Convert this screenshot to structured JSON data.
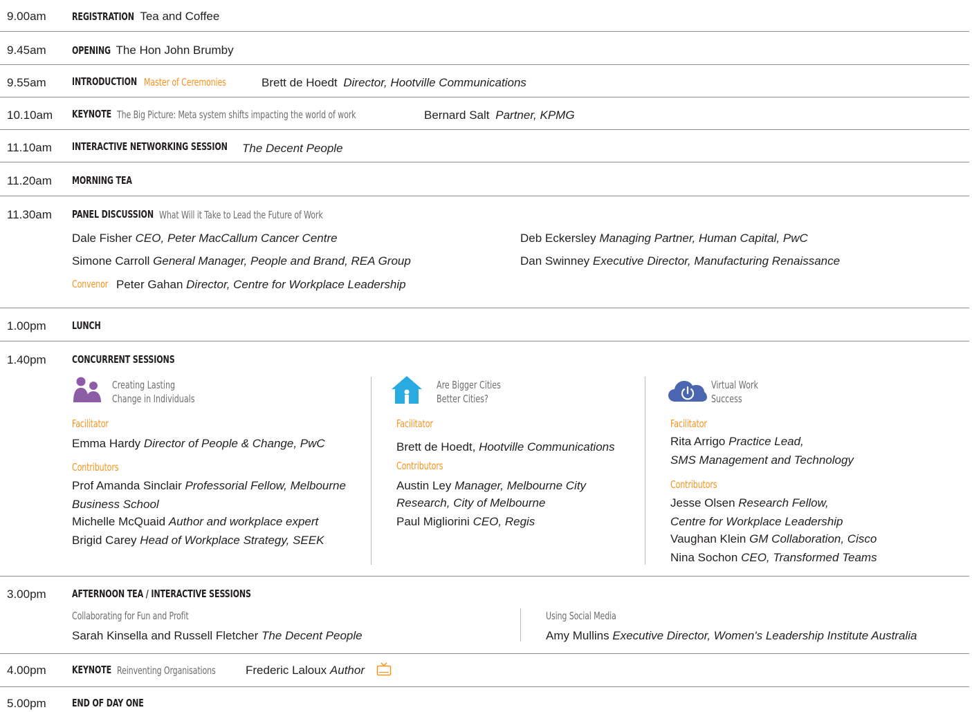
{
  "rows": [
    {
      "time": "9.00am",
      "label": "REGISTRATION",
      "detail": "Tea and Coffee"
    },
    {
      "time": "9.45am",
      "label": "OPENING",
      "detail": "The Hon John Brumby"
    },
    {
      "time": "9.55am",
      "label": "INTRODUCTION",
      "role": "Master of Ceremonies",
      "name": "Brett de Hoedt",
      "title": "Director, Hootville Communications"
    },
    {
      "time": "10.10am",
      "label": "KEYNOTE",
      "topic": "The Big Picture: Meta system shifts impacting the world of work",
      "name": "Bernard Salt",
      "title": "Partner, KPMG"
    },
    {
      "time": "11.10am",
      "label": "INTERACTIVE NETWORKING SESSION",
      "title": "The Decent People"
    },
    {
      "time": "11.20am",
      "label": "MORNING TEA"
    },
    {
      "time": "11.30am",
      "label": "PANEL DISCUSSION",
      "topic": "What Will it Take to Lead the Future of Work"
    },
    {
      "time": "1.00pm",
      "label": "LUNCH"
    },
    {
      "time": "1.40pm",
      "label": "CONCURRENT SESSIONS"
    },
    {
      "time": "3.00pm",
      "label": "AFTERNOON TEA / INTERACTIVE SESSIONS"
    },
    {
      "time": "4.00pm",
      "label": "KEYNOTE",
      "topic": "Reinventing Organisations",
      "name": "Frederic Laloux",
      "title": "Author"
    },
    {
      "time": "5.00pm",
      "label": "END OF DAY ONE"
    }
  ],
  "panel": {
    "left": [
      {
        "name": "Dale Fisher",
        "title": "CEO, Peter MacCallum Cancer Centre"
      },
      {
        "name": "Simone Carroll",
        "title": "General Manager, People and Brand, REA Group"
      }
    ],
    "right": [
      {
        "name": "Deb Eckersley",
        "title": "Managing Partner, Human Capital, PwC"
      },
      {
        "name": "Dan Swinney",
        "title": "Executive Director, Manufacturing Renaissance"
      }
    ],
    "convenor_label": "Convenor",
    "convenor_name": "Peter Gahan",
    "convenor_title": "Director, Centre for Workplace Leadership"
  },
  "sessions": [
    {
      "icon": "people-icon",
      "title_line1": "Creating Lasting",
      "title_line2": "Change in Individuals",
      "facilitator_label": "Facilitator",
      "facilitator_name": "Emma Hardy",
      "facilitator_title": "Director of People & Change, PwC",
      "contributors_label": "Contributors",
      "c1_name": "Prof Amanda Sinclair",
      "c1_title_a": "Professorial Fellow, Melbourne",
      "c1_title_b": "Business School",
      "c2_name": "Michelle McQuaid",
      "c2_title": "Author and workplace expert",
      "c3_name": "Brigid Carey",
      "c3_title": "Head of Workplace Strategy, SEEK"
    },
    {
      "icon": "house-icon",
      "title_line1": "Are Bigger Cities",
      "title_line2": "Better Cities?",
      "facilitator_label": "Facilitator",
      "facilitator_name": "Brett de Hoedt,",
      "facilitator_title": "Hootville Communications",
      "contributors_label": "Contributors",
      "c1_name": "Austin Ley",
      "c1_title_a": "Manager, Melbourne City",
      "c1_title_b": "Research, City of Melbourne",
      "c2_name": "Paul Migliorini",
      "c2_title": "CEO, Regis"
    },
    {
      "icon": "cloud-power-icon",
      "title_line1": "Virtual Work",
      "title_line2": "Success",
      "facilitator_label": "Facilitator",
      "facilitator_name": "Rita Arrigo",
      "facilitator_title_a": "Practice Lead,",
      "facilitator_title_b": "SMS Management and Technology",
      "contributors_label": "Contributors",
      "c1_name": "Jesse Olsen",
      "c1_title_a": "Research Fellow,",
      "c1_title_b": "Centre for Workplace Leadership",
      "c2_name": "Vaughan Klein",
      "c2_title": "GM Collaboration, Cisco",
      "c3_name": "Nina Sochon",
      "c3_title": "CEO, Transformed Teams"
    }
  ],
  "afternoon": [
    {
      "topic": "Collaborating for Fun and Profit",
      "name": "Sarah Kinsella and Russell Fletcher",
      "title": "The Decent People"
    },
    {
      "topic": "Using Social Media",
      "name": "Amy Mullins",
      "title": "Executive Director, Women's Leadership Institute Australia"
    }
  ],
  "colors": {
    "accent": "#f7941d",
    "people_icon": "#8e5ba6",
    "house_icon": "#29abe2",
    "cloud_icon": "#4a66b0"
  }
}
